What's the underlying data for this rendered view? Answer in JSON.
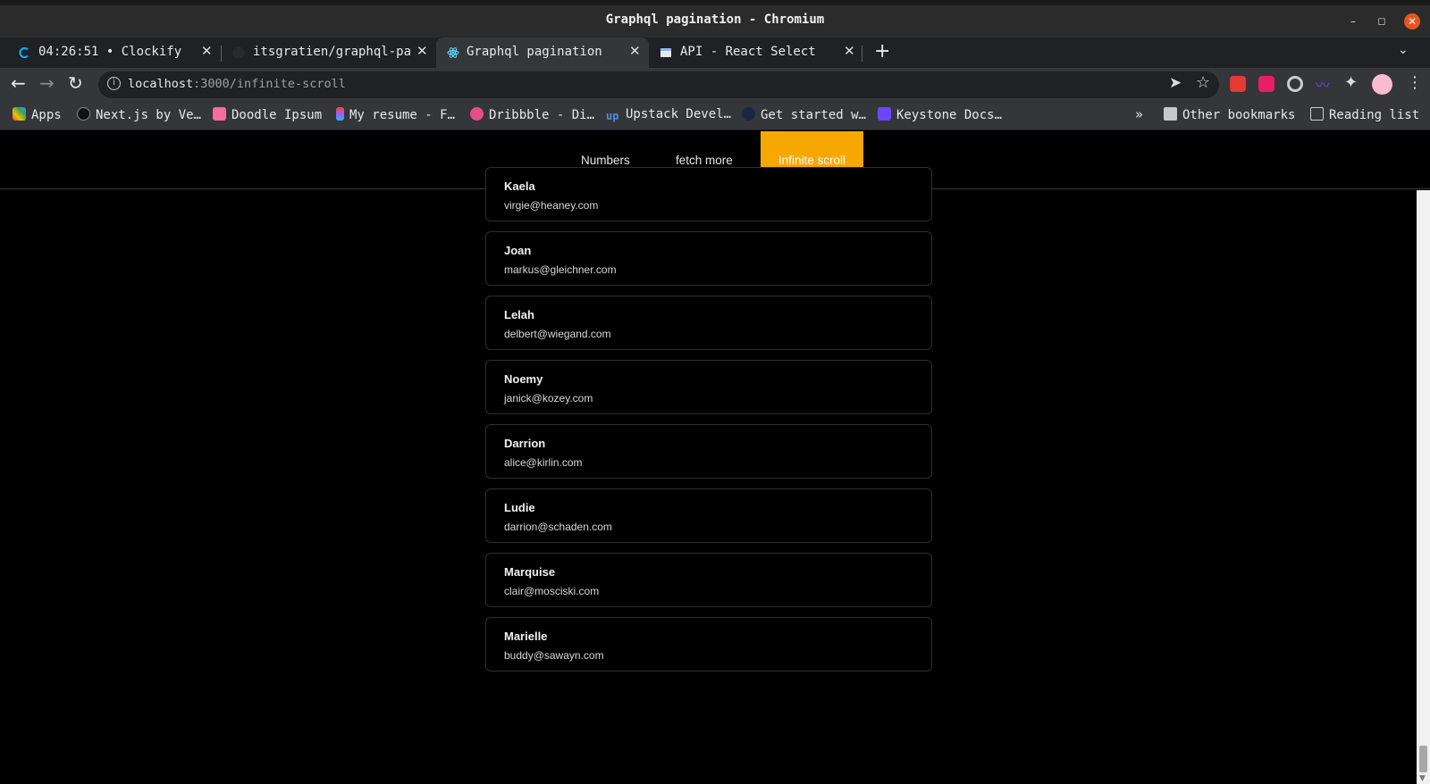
{
  "window": {
    "title": "Graphql pagination - Chromium"
  },
  "tabs": [
    {
      "label": "04:26:51 • Clockify"
    },
    {
      "label": "itsgratien/graphql-pagi"
    },
    {
      "label": "Graphql pagination"
    },
    {
      "label": "API - React Select"
    }
  ],
  "address": {
    "host": "localhost",
    "path": ":3000/infinite-scroll"
  },
  "bookmarks": {
    "items": [
      {
        "label": "Apps"
      },
      {
        "label": "Next.js by Ve…"
      },
      {
        "label": "Doodle Ipsum"
      },
      {
        "label": "My resume - F…"
      },
      {
        "label": "Dribbble - Di…"
      },
      {
        "label": "Upstack Devel…"
      },
      {
        "label": "Get started w…"
      },
      {
        "label": "Keystone Docs…"
      }
    ],
    "more": "»",
    "other": "Other bookmarks",
    "reading_list": "Reading list"
  },
  "navbar": {
    "links": [
      {
        "label": "Numbers"
      },
      {
        "label": "fetch more"
      },
      {
        "label": "Infinite scroll"
      }
    ],
    "active": "Infinite scroll",
    "accent_color": "#f6a800"
  },
  "users": [
    {
      "name": "Kaela",
      "email": "virgie@heaney.com"
    },
    {
      "name": "Joan",
      "email": "markus@gleichner.com"
    },
    {
      "name": "Lelah",
      "email": "delbert@wiegand.com"
    },
    {
      "name": "Noemy",
      "email": "janick@kozey.com"
    },
    {
      "name": "Darrion",
      "email": "alice@kirlin.com"
    },
    {
      "name": "Ludie",
      "email": "darrion@schaden.com"
    },
    {
      "name": "Marquise",
      "email": "clair@mosciski.com"
    },
    {
      "name": "Marielle",
      "email": "buddy@sawayn.com"
    }
  ]
}
